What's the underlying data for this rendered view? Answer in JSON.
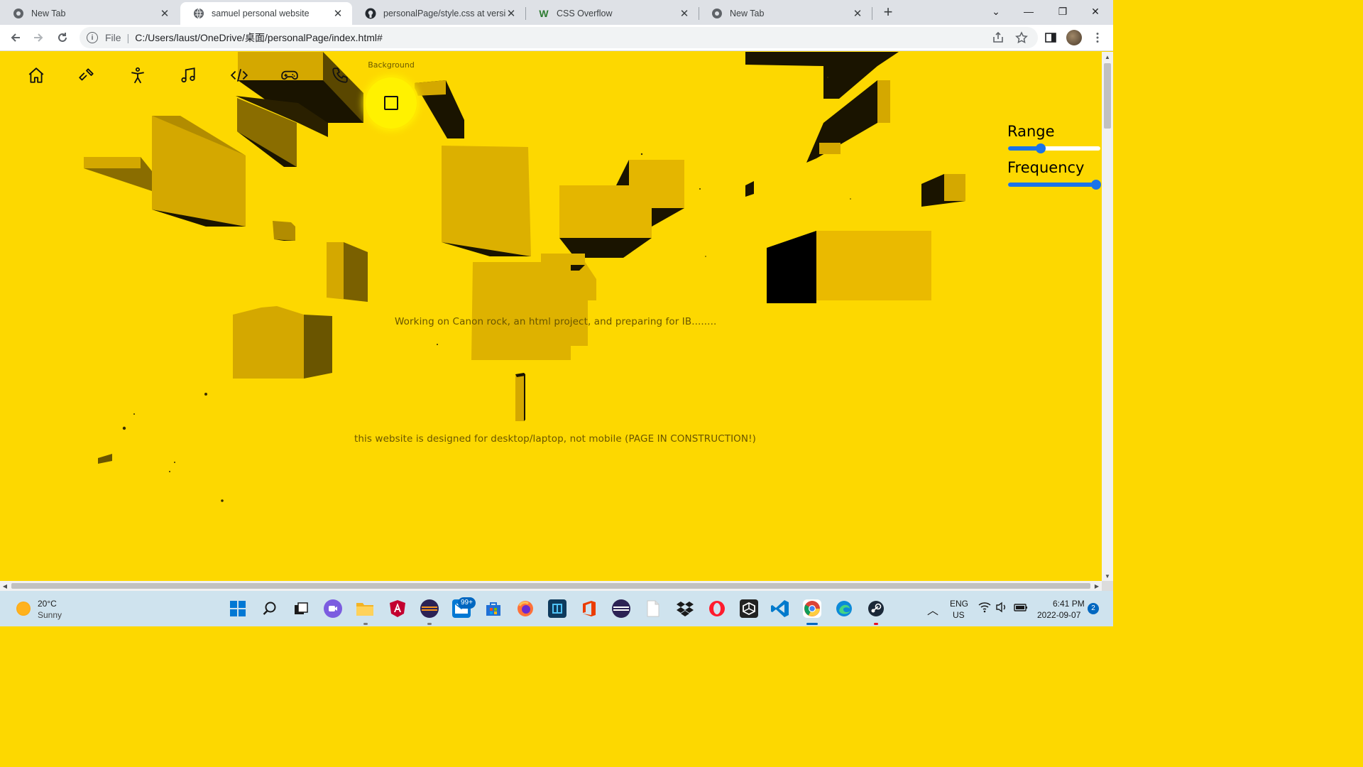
{
  "browser": {
    "tabs": [
      {
        "label": "New Tab",
        "icon": "chrome-icon",
        "active": false
      },
      {
        "label": "samuel personal website",
        "icon": "globe-icon",
        "active": true
      },
      {
        "label": "personalPage/style.css at version",
        "icon": "github-icon",
        "active": false
      },
      {
        "label": "CSS Overflow",
        "icon": "w-icon",
        "active": false
      },
      {
        "label": "New Tab",
        "icon": "chrome-icon",
        "active": false
      }
    ],
    "new_tab_symbol": "+",
    "address": {
      "scheme_label": "File",
      "url": "C:/Users/laust/OneDrive/桌面/personalPage/index.html#"
    }
  },
  "page": {
    "nav": [
      {
        "name": "home",
        "icon": "home-icon"
      },
      {
        "name": "tools",
        "icon": "hammer-icon"
      },
      {
        "name": "about",
        "icon": "person-icon"
      },
      {
        "name": "music",
        "icon": "music-note-icon"
      },
      {
        "name": "code",
        "icon": "code-icon"
      },
      {
        "name": "games",
        "icon": "gamepad-icon"
      },
      {
        "name": "contact",
        "icon": "phone-icon"
      }
    ],
    "background_toggle": {
      "label": "Background",
      "icon": "square-icon"
    },
    "controls": {
      "range": {
        "label": "Range",
        "value": 0.35
      },
      "frequency": {
        "label": "Frequency",
        "value": 0.95
      }
    },
    "status_text": "Working on Canon rock, an html project, and preparing for IB........",
    "notice_text": "this website is designed for desktop/laptop, not mobile (PAGE IN CONSTRUCTION!)",
    "colors": {
      "background": "#fdd800",
      "cube_face": "#d4a800",
      "cube_shadow": "#1a1400",
      "slider_accent": "#1a73e8"
    }
  },
  "taskbar": {
    "weather": {
      "temp": "20°C",
      "condition": "Sunny"
    },
    "apps": [
      {
        "name": "start",
        "icon": "windows-icon"
      },
      {
        "name": "search",
        "icon": "search-icon"
      },
      {
        "name": "task-view",
        "icon": "task-view-icon"
      },
      {
        "name": "chat",
        "icon": "chat-icon"
      },
      {
        "name": "file-explorer",
        "icon": "folder-icon"
      },
      {
        "name": "angular",
        "icon": "angular-icon"
      },
      {
        "name": "eclipse",
        "icon": "eclipse-icon"
      },
      {
        "name": "mail",
        "icon": "mail-icon",
        "badge": "99+"
      },
      {
        "name": "store",
        "icon": "store-icon"
      },
      {
        "name": "firefox",
        "icon": "firefox-icon"
      },
      {
        "name": "app-blue",
        "icon": "package-icon"
      },
      {
        "name": "office",
        "icon": "office-icon"
      },
      {
        "name": "eclipse-2",
        "icon": "eclipse-icon"
      },
      {
        "name": "notepad",
        "icon": "file-icon"
      },
      {
        "name": "dropbox",
        "icon": "dropbox-icon"
      },
      {
        "name": "opera",
        "icon": "opera-icon"
      },
      {
        "name": "unity",
        "icon": "unity-icon"
      },
      {
        "name": "vscode",
        "icon": "vscode-icon"
      },
      {
        "name": "chrome",
        "icon": "chrome-icon"
      },
      {
        "name": "edge",
        "icon": "edge-icon"
      },
      {
        "name": "steam",
        "icon": "steam-icon"
      }
    ],
    "tray": {
      "lang_top": "ENG",
      "lang_bottom": "US",
      "time": "6:41 PM",
      "date": "2022-09-07",
      "notification_count": "2"
    }
  }
}
